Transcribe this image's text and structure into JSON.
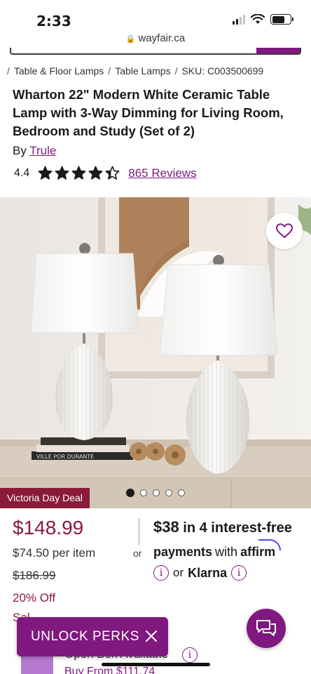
{
  "status": {
    "time": "2:33"
  },
  "browser": {
    "url": "wayfair.ca"
  },
  "breadcrumb": {
    "items": [
      "Table & Floor Lamps",
      "Table Lamps"
    ],
    "sku": "SKU: C003500699"
  },
  "product": {
    "title": "Wharton 22\" Modern White Ceramic Table Lamp with 3-Way Dimming for Living Room, Bedroom and Study (Set of 2)",
    "by_label": "By",
    "brand": "Trule",
    "rating": "4.4",
    "rating_value": 4.4,
    "rating_max": 5,
    "reviews": "865 Reviews"
  },
  "gallery": {
    "deal_badge": "Victoria Day Deal",
    "book_spine_text": "VILLE POR DURANTE",
    "slide_count": 5,
    "active_slide": 1
  },
  "pricing": {
    "price": "$148.99",
    "per_item": "$74.50 per item",
    "original_price": "$186.99",
    "discount": "20% Off",
    "cutoff_text": "Sal"
  },
  "financing": {
    "or_label": "or",
    "amount": "$38",
    "line1_rest": "in 4 interest-free",
    "line2_prefix": "payments",
    "line2_with": "with",
    "affirm_logo": "affirm",
    "or_klarna_prefix": "or",
    "klarna": "Klarna"
  },
  "open_box": {
    "title": "Open Box Available",
    "link": "Buy From $111.74"
  },
  "perks": {
    "label": "UNLOCK PERKS"
  },
  "colors": {
    "brand_purple": "#7f187f",
    "sale_red": "#8a1a3a",
    "affirm_blue": "#4a4af4"
  }
}
